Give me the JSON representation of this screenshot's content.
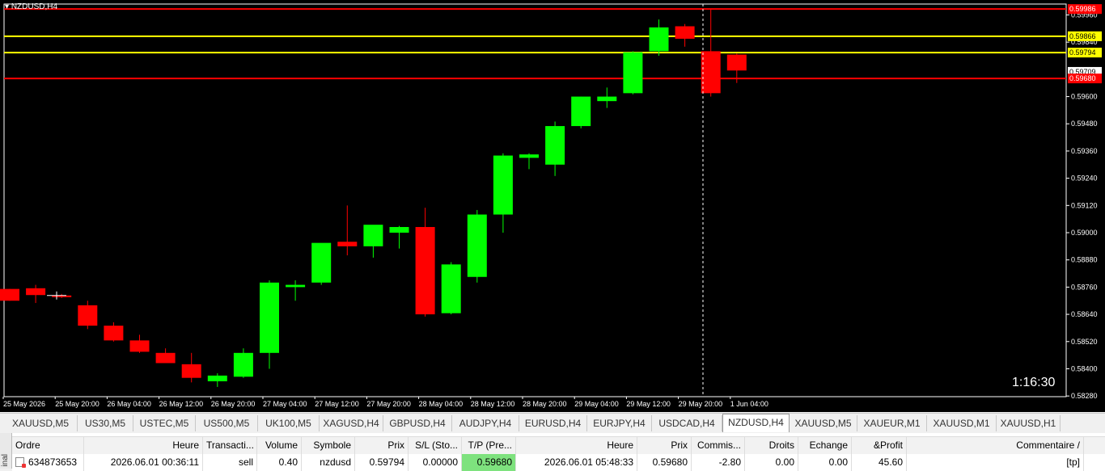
{
  "chart": {
    "symbol_label": "NZDUSD,H4",
    "timer": "1:16:30",
    "colors": {
      "background": "#000000",
      "bull": "#00ff00",
      "bear": "#ff0000",
      "text": "#ffffff"
    },
    "price_ticks": [
      "0.59960",
      "0.59840",
      "0.59600",
      "0.59480",
      "0.59360",
      "0.59240",
      "0.59120",
      "0.59000",
      "0.58880",
      "0.58760",
      "0.58640",
      "0.58520",
      "0.58400",
      "0.58280"
    ],
    "time_labels": [
      "25 May 2026",
      "25 May 20:00",
      "26 May 04:00",
      "26 May 12:00",
      "26 May 20:00",
      "27 May 04:00",
      "27 May 12:00",
      "27 May 20:00",
      "28 May 04:00",
      "28 May 12:00",
      "28 May 20:00",
      "29 May 04:00",
      "29 May 12:00",
      "29 May 20:00",
      "1 Jun 04:00"
    ],
    "levels": [
      {
        "name": "top-red-level",
        "price": 0.59986,
        "color": "#ff0000",
        "label": "0.59986"
      },
      {
        "name": "upper-yellow-level",
        "price": 0.59866,
        "color": "#ffff00",
        "label": "0.59866"
      },
      {
        "name": "lower-yellow-level",
        "price": 0.59794,
        "color": "#ffff00",
        "label": "0.59794"
      },
      {
        "name": "bid-level",
        "price": 0.59709,
        "color": "#ffffff",
        "label": "0.59709"
      },
      {
        "name": "tp-red-level",
        "price": 0.5968,
        "color": "#ff0000",
        "label": "0.59680"
      }
    ],
    "candles": [
      [
        0.58752,
        0.58752,
        0.587,
        0.587
      ],
      [
        0.58755,
        0.5877,
        0.5869,
        0.58725
      ],
      [
        0.58723,
        0.5873,
        0.58712,
        0.5872
      ],
      [
        0.5868,
        0.587,
        0.58575,
        0.5859
      ],
      [
        0.5859,
        0.58605,
        0.5852,
        0.58525
      ],
      [
        0.58525,
        0.5855,
        0.5847,
        0.58475
      ],
      [
        0.5847,
        0.5849,
        0.5843,
        0.58425
      ],
      [
        0.5842,
        0.5847,
        0.5834,
        0.5836
      ],
      [
        0.58345,
        0.5838,
        0.5832,
        0.5837
      ],
      [
        0.58365,
        0.5849,
        0.5836,
        0.5847
      ],
      [
        0.5847,
        0.5879,
        0.584,
        0.5878
      ],
      [
        0.5876,
        0.5879,
        0.587,
        0.5877
      ],
      [
        0.5878,
        0.5895,
        0.5877,
        0.58955
      ],
      [
        0.5896,
        0.5912,
        0.589,
        0.5894
      ],
      [
        0.5894,
        0.5903,
        0.5889,
        0.59035
      ],
      [
        0.59,
        0.5903,
        0.5893,
        0.59025
      ],
      [
        0.59025,
        0.5911,
        0.5863,
        0.5864
      ],
      [
        0.58645,
        0.5887,
        0.5864,
        0.5886
      ],
      [
        0.58805,
        0.591,
        0.5878,
        0.5908
      ],
      [
        0.5908,
        0.5935,
        0.59,
        0.5934
      ],
      [
        0.5933,
        0.5935,
        0.5928,
        0.59345
      ],
      [
        0.593,
        0.5949,
        0.5925,
        0.5947
      ],
      [
        0.5947,
        0.596,
        0.5946,
        0.596
      ],
      [
        0.5958,
        0.5964,
        0.5955,
        0.596
      ],
      [
        0.59615,
        0.598,
        0.5961,
        0.59795
      ],
      [
        0.598,
        0.5994,
        0.5978,
        0.59905
      ],
      [
        0.5991,
        0.5992,
        0.5982,
        0.59855
      ],
      [
        0.598,
        0.59986,
        0.596,
        0.59615
      ],
      [
        0.59785,
        0.5979,
        0.5966,
        0.59715
      ]
    ]
  },
  "tabs": [
    {
      "label": "XAUUSD,M5",
      "active": false
    },
    {
      "label": "US30,M5",
      "active": false
    },
    {
      "label": "USTEC,M5",
      "active": false
    },
    {
      "label": "US500,M5",
      "active": false
    },
    {
      "label": "UK100,M5",
      "active": false
    },
    {
      "label": "XAGUSD,H4",
      "active": false
    },
    {
      "label": "GBPUSD,H4",
      "active": false
    },
    {
      "label": "AUDJPY,H4",
      "active": false
    },
    {
      "label": "EURUSD,H4",
      "active": false
    },
    {
      "label": "EURJPY,H4",
      "active": false
    },
    {
      "label": "USDCAD,H4",
      "active": false
    },
    {
      "label": "NZDUSD,H4",
      "active": true
    },
    {
      "label": "XAUUSD,M5",
      "active": false
    },
    {
      "label": "XAUEUR,M1",
      "active": false
    },
    {
      "label": "XAUUSD,M1",
      "active": false
    },
    {
      "label": "XAUUSD,H1",
      "active": false
    }
  ],
  "terminal": {
    "side_label": "inal",
    "headers": [
      "Ordre",
      "Heure",
      "Transacti...",
      "Volume",
      "Symbole",
      "Prix",
      "S/L (Sto...",
      "T/P (Pre...",
      "Heure",
      "Prix",
      "Commis...",
      "Droits",
      "Echange",
      "&Profit",
      "Commentaire"
    ],
    "sort_arrow": "/",
    "row": {
      "ordre": "634873653",
      "heure_open": "2026.06.01 00:36:11",
      "transaction": "sell",
      "volume": "0.40",
      "symbole": "nzdusd",
      "prix_open": "0.59794",
      "sl": "0.00000",
      "tp": "0.59680",
      "heure_now": "2026.06.01 05:48:33",
      "prix_now": "0.59680",
      "commission": "-2.80",
      "droits": "0.00",
      "echange": "0.00",
      "profit": "45.60",
      "commentaire": "[tp]"
    }
  }
}
